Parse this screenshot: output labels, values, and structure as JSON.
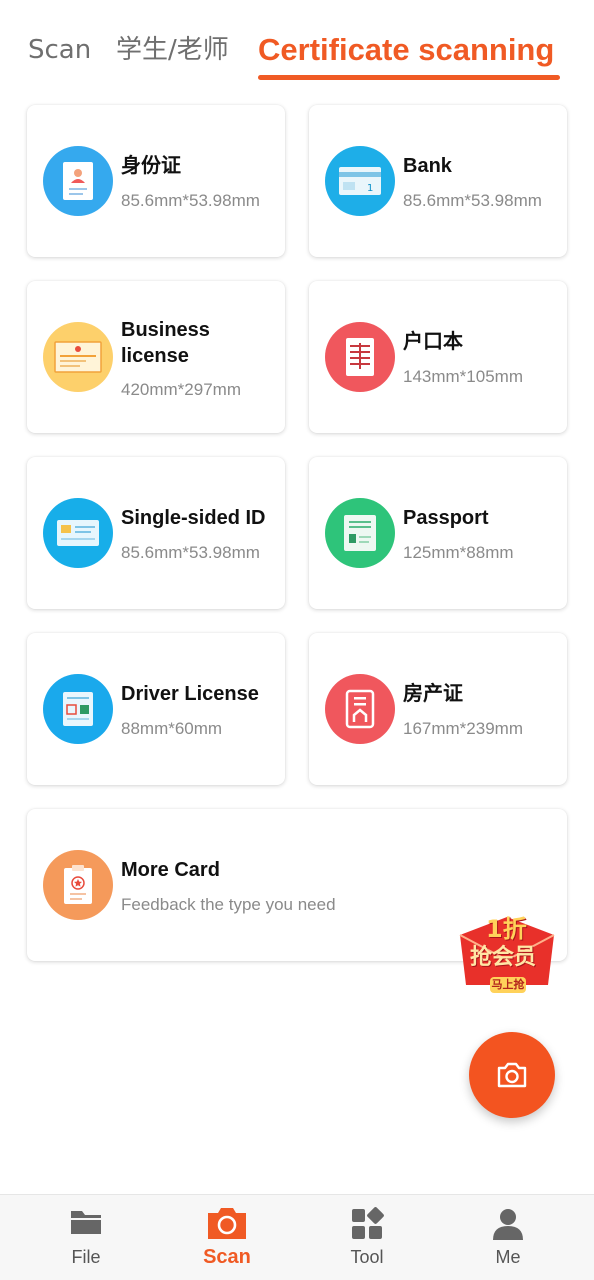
{
  "top_tabs": {
    "scan": "Scan",
    "student_teacher": "学生/老师",
    "certificate": "Certificate scanning"
  },
  "cards": [
    {
      "title": "身份证",
      "size": "85.6mm*53.98mm",
      "icon": "id-card-icon",
      "color": "#35a9ee"
    },
    {
      "title": "Bank",
      "size": "85.6mm*53.98mm",
      "icon": "bank-card-icon",
      "color": "#1eaee8"
    },
    {
      "title": "Business license",
      "size": "420mm*297mm",
      "icon": "business-license-icon",
      "color": "#fdd06b"
    },
    {
      "title": "户口本",
      "size": "143mm*105mm",
      "icon": "household-register-icon",
      "color": "#f0575d"
    },
    {
      "title": "Single-sided ID",
      "size": "85.6mm*53.98mm",
      "icon": "single-id-icon",
      "color": "#17aee9"
    },
    {
      "title": "Passport",
      "size": "125mm*88mm",
      "icon": "passport-icon",
      "color": "#2ec47a"
    },
    {
      "title": "Driver License",
      "size": "88mm*60mm",
      "icon": "driver-license-icon",
      "color": "#1aa9ec"
    },
    {
      "title": "房产证",
      "size": "167mm*239mm",
      "icon": "property-certificate-icon",
      "color": "#f0575d"
    },
    {
      "title": "More Card",
      "size": "Feedback the type you need",
      "icon": "more-card-icon",
      "color": "#f59a5b"
    }
  ],
  "promo": {
    "line1": "1折",
    "line2": "抢会员",
    "button": "马上抢"
  },
  "nav": {
    "file": "File",
    "scan": "Scan",
    "tool": "Tool",
    "me": "Me"
  },
  "colors": {
    "accent": "#f05a24",
    "nav_inactive": "#555555"
  }
}
